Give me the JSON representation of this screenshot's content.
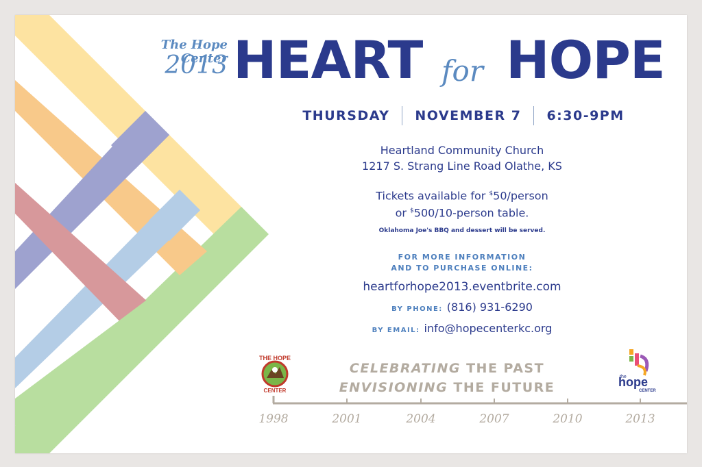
{
  "header": {
    "org_name": "The Hope Center",
    "year": "2013",
    "title_part1": "HEART",
    "title_for": "for",
    "title_part2": "HOPE"
  },
  "event": {
    "day": "THURSDAY",
    "date": "NOVEMBER 7",
    "time": "6:30-9PM",
    "venue_name": "Heartland Community Church",
    "venue_address": "1217 S. Strang Line Road Olathe, KS",
    "tickets_line1_pre": "Tickets available for ",
    "tickets_line1_sup": "$",
    "tickets_line1_post": "50/person",
    "tickets_line2_pre": "or ",
    "tickets_line2_sup": "$",
    "tickets_line2_post": "500/10-person table.",
    "food_note": "Oklahoma Joe's BBQ and dessert will be served."
  },
  "contact": {
    "more_info_line1": "FOR MORE INFORMATION",
    "more_info_line2": "AND TO PURCHASE ONLINE:",
    "website": "heartforhope2013.eventbrite.com",
    "phone_label": "BY PHONE:",
    "phone": "(816) 931-6290",
    "email_label": "BY EMAIL:",
    "email": "info@hopecenterkc.org"
  },
  "tagline": {
    "line1_em": "CELEBRATING",
    "line1_rest": " THE PAST",
    "line2_em": "ENVISIONING",
    "line2_rest": " THE FUTURE"
  },
  "timeline_years": [
    "1998",
    "2001",
    "2004",
    "2007",
    "2010",
    "2013"
  ],
  "logos": {
    "left_text_top": "THE HOPE",
    "left_text_bottom": "CENTER",
    "right_text_small": "the",
    "right_text_main": "hope",
    "right_text_sub": "CENTER"
  },
  "colors": {
    "navy": "#2b3a8c",
    "light_blue": "#5b8ac0",
    "tan_gray": "#b3aba0",
    "ribbon_yellow": "#fde3a1",
    "ribbon_orange": "#f8c98a",
    "ribbon_purple": "#9ea2cf",
    "ribbon_rose": "#d7989b",
    "ribbon_sky": "#b4cde6",
    "ribbon_green": "#b8deA0"
  }
}
